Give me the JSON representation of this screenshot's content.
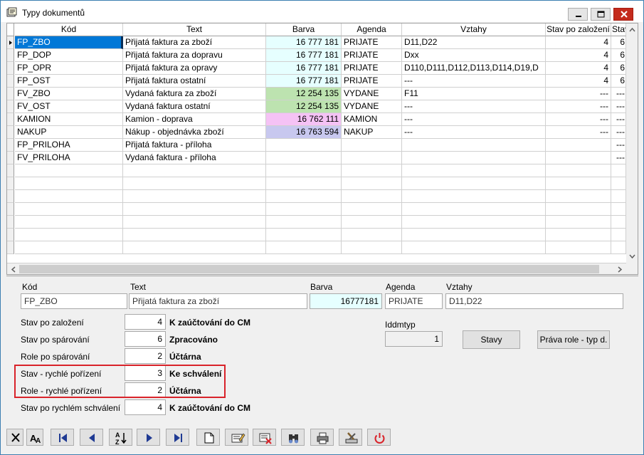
{
  "window": {
    "title": "Typy dokumentů"
  },
  "grid": {
    "columns": [
      "Kód",
      "Text",
      "Barva",
      "Agenda",
      "Vztahy",
      "Stav po založení",
      "Stav"
    ],
    "rows": [
      {
        "kod": "FP_ZBO",
        "text": "Přijatá faktura za zboží",
        "barva": "16 777 181",
        "agenda": "PRIJATE",
        "vztahy": "D11,D22",
        "stav": "4",
        "stav2": "6",
        "color": "#e6ffff",
        "selected": true
      },
      {
        "kod": "FP_DOP",
        "text": "Přijatá faktura za dopravu",
        "barva": "16 777 181",
        "agenda": "PRIJATE",
        "vztahy": "Dxx",
        "stav": "4",
        "stav2": "6",
        "color": "#e6ffff",
        "selected": false
      },
      {
        "kod": "FP_OPR",
        "text": "Přijatá faktura za opravy",
        "barva": "16 777 181",
        "agenda": "PRIJATE",
        "vztahy": "D110,D111,D112,D113,D114,D19,D",
        "stav": "4",
        "stav2": "6",
        "color": "#e6ffff",
        "selected": false
      },
      {
        "kod": "FP_OST",
        "text": "Přijatá faktura ostatní",
        "barva": "16 777 181",
        "agenda": "PRIJATE",
        "vztahy": "---",
        "stav": "4",
        "stav2": "6",
        "color": "#e6ffff",
        "selected": false
      },
      {
        "kod": "FV_ZBO",
        "text": "Vydaná faktura za zboží",
        "barva": "12 254 135",
        "agenda": "VYDANE",
        "vztahy": "F11",
        "stav": "---",
        "stav2": "---",
        "color": "#bde3b0",
        "selected": false
      },
      {
        "kod": "FV_OST",
        "text": "Vydaná faktura ostatní",
        "barva": "12 254 135",
        "agenda": "VYDANE",
        "vztahy": "---",
        "stav": "---",
        "stav2": "---",
        "color": "#bde3b0",
        "selected": false
      },
      {
        "kod": "KAMION",
        "text": "Kamion - doprava",
        "barva": "16 762 111",
        "agenda": "KAMION",
        "vztahy": "---",
        "stav": "---",
        "stav2": "---",
        "color": "#f5c2f5",
        "selected": false
      },
      {
        "kod": "NAKUP",
        "text": "Nákup - objednávka zboží",
        "barva": "16 763 594",
        "agenda": "NAKUP",
        "vztahy": "---",
        "stav": "---",
        "stav2": "---",
        "color": "#c8c8ef",
        "selected": false
      },
      {
        "kod": "FP_PRILOHA",
        "text": "Přijatá faktura - příloha",
        "barva": "",
        "agenda": "",
        "vztahy": "",
        "stav": "",
        "stav2": "---",
        "color": "#ffffff",
        "selected": false
      },
      {
        "kod": "FV_PRILOHA",
        "text": "Vydaná faktura - příloha",
        "barva": "",
        "agenda": "",
        "vztahy": "",
        "stav": "",
        "stav2": "---",
        "color": "#ffffff",
        "selected": false
      }
    ],
    "empty_rows": 7
  },
  "detail": {
    "kod_label": "Kód",
    "kod_value": "FP_ZBO",
    "text_label": "Text",
    "text_value": "Přijatá faktura za zboží",
    "barva_label": "Barva",
    "barva_value": "16777181",
    "agenda_label": "Agenda",
    "agenda_value": "PRIJATE",
    "vztahy_label": "Vztahy",
    "vztahy_value": "D11,D22",
    "stav_zalozeni_label": "Stav po založení",
    "stav_zalozeni_value": "4",
    "stav_zalozeni_desc": "K zaúčtování do CM",
    "stav_parovani_label": "Stav po spárování",
    "stav_parovani_value": "6",
    "stav_parovani_desc": "Zpracováno",
    "role_parovani_label": "Role po spárování",
    "role_parovani_value": "2",
    "role_parovani_desc": "Účtárna",
    "stav_rychle_label": "Stav - rychlé pořízení",
    "stav_rychle_value": "3",
    "stav_rychle_desc": "Ke schválení",
    "role_rychle_label": "Role - rychlé pořízení",
    "role_rychle_value": "2",
    "role_rychle_desc": "Účtárna",
    "stav_schvaleni_label": "Stav po rychlém schválení",
    "stav_schvaleni_value": "4",
    "stav_schvaleni_desc": "K zaúčtování do CM",
    "iddmtyp_label": "Iddmtyp",
    "iddmtyp_value": "1",
    "stavy_button": "Stavy",
    "prava_button": "Práva role - typ d."
  },
  "colors": {
    "selection": "#0078d7",
    "highlight_box": "#d9232a"
  }
}
